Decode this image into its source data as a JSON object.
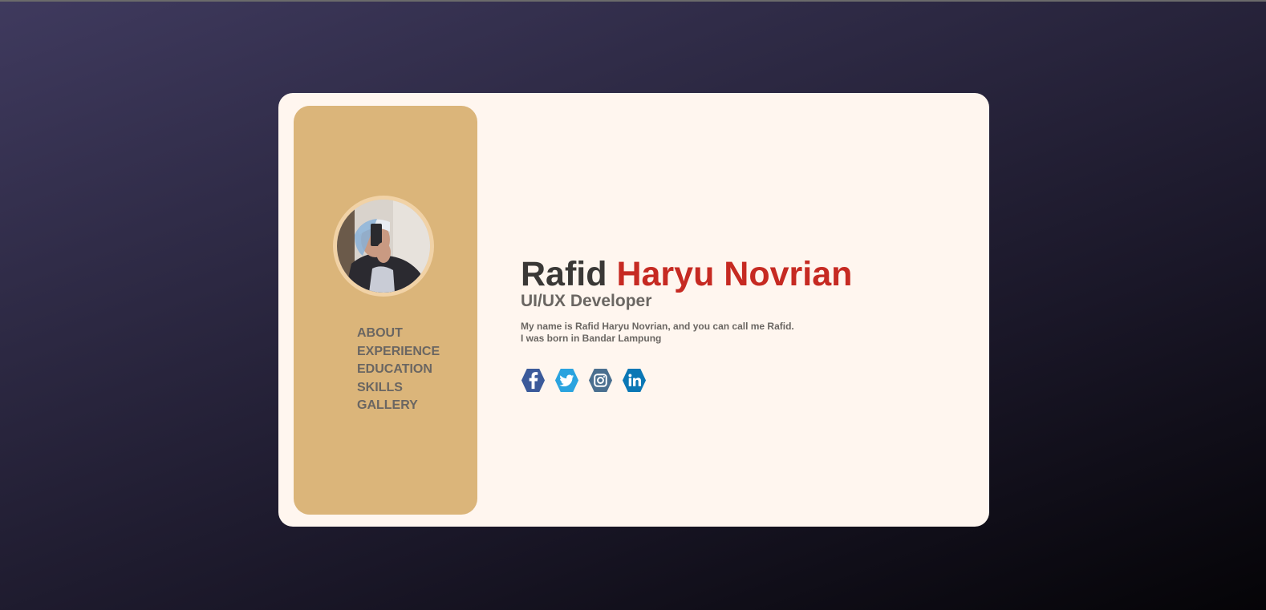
{
  "profile": {
    "first_name": "Rafid",
    "last_name": "Haryu Novrian",
    "role": "UI/UX Developer",
    "bio_line1": "My name is Rafid Haryu Novrian, and you can call me Rafid.",
    "bio_line2": "I was born in Bandar Lampung"
  },
  "nav": {
    "items": [
      "ABOUT",
      "EXPERIENCE",
      "EDUCATION",
      "SKILLS",
      "GALLERY"
    ]
  },
  "social": [
    {
      "icon": "facebook-icon",
      "color": "#3b5a9a"
    },
    {
      "icon": "twitter-icon",
      "color": "#2aa3df"
    },
    {
      "icon": "instagram-icon",
      "color": "#4a6f8f"
    },
    {
      "icon": "linkedin-icon",
      "color": "#0a77b5"
    }
  ],
  "colors": {
    "card_bg": "#fff6ef",
    "sidebar_bg": "#dbb57a",
    "accent_red": "#c62a22",
    "text_dark": "#3a3836",
    "text_muted": "#6a6662"
  }
}
